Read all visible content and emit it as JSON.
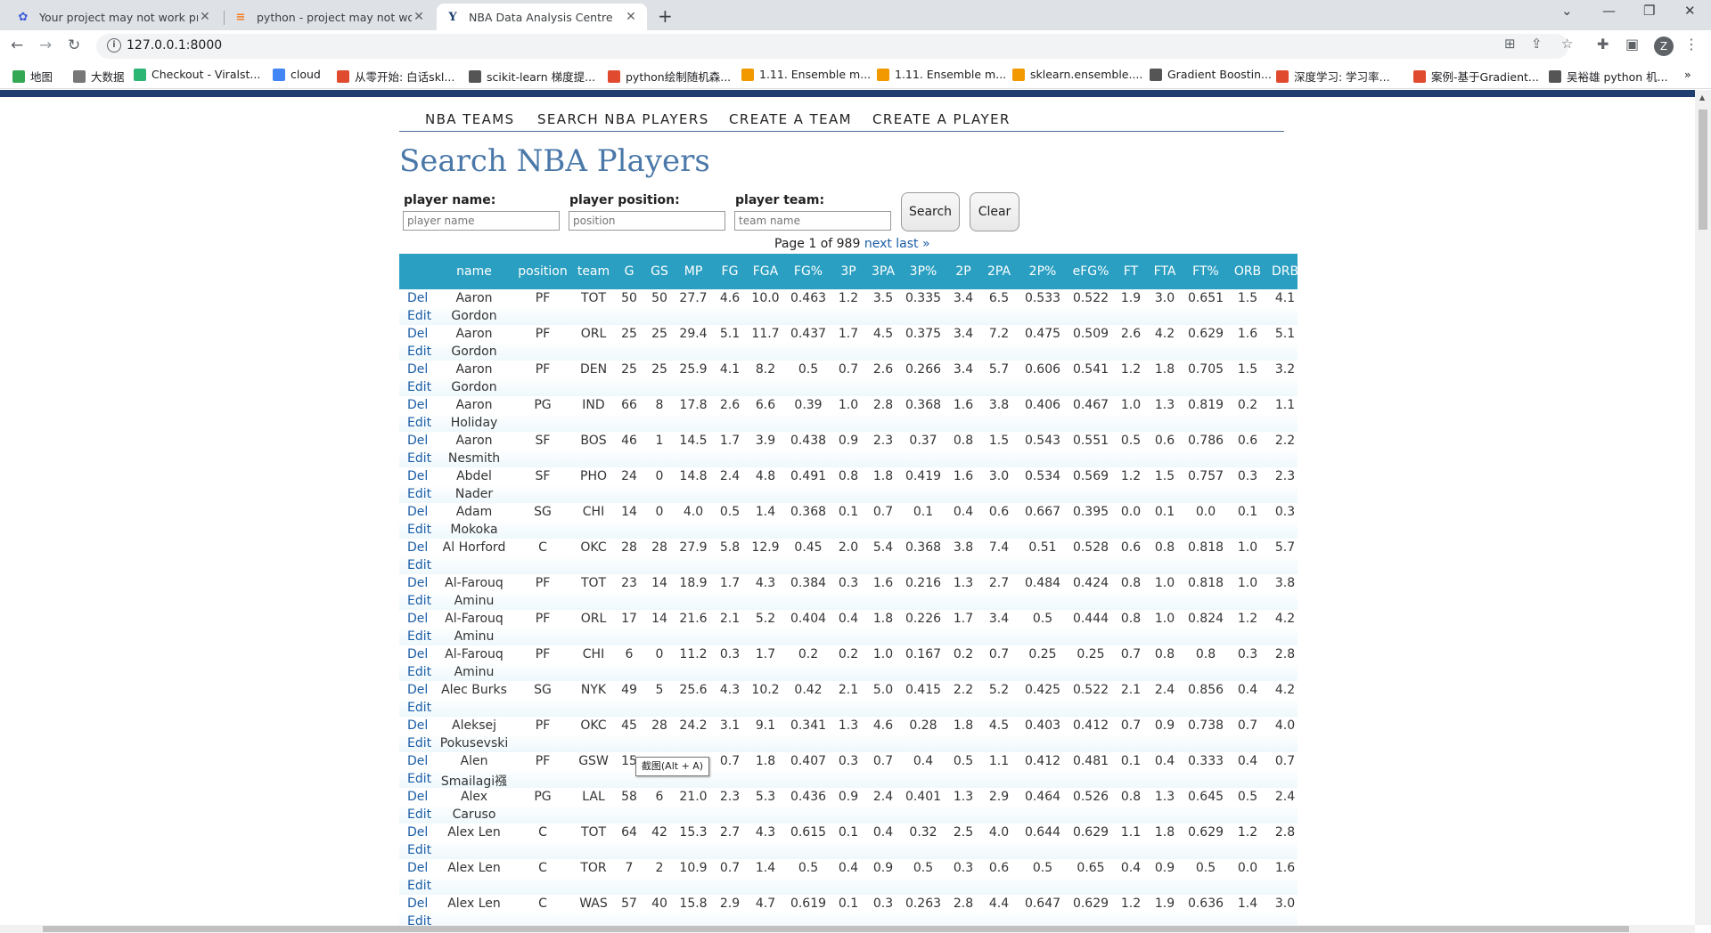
{
  "tabs": [
    {
      "title": "Your project may not work pro",
      "icon": "paw-icon"
    },
    {
      "title": "python - project may not work",
      "icon": "stack-icon"
    },
    {
      "title": "NBA Data Analysis Centre",
      "icon": "y-icon"
    }
  ],
  "url": "127.0.0.1:8000",
  "profile_initial": "Z",
  "bookmarks": [
    {
      "label": "地图",
      "color": "#34a853"
    },
    {
      "label": "大数据",
      "color": "#777777"
    },
    {
      "label": "Checkout - Viralst...",
      "color": "#2bb673"
    },
    {
      "label": "cloud",
      "color": "#4285f4"
    },
    {
      "label": "从零开始: 白话skl...",
      "color": "#e04a2f"
    },
    {
      "label": "scikit-learn 梯度提...",
      "color": "#555555"
    },
    {
      "label": "python绘制随机森...",
      "color": "#e04a2f"
    },
    {
      "label": "1.11. Ensemble m...",
      "color": "#f29900"
    },
    {
      "label": "1.11. Ensemble m...",
      "color": "#f29900"
    },
    {
      "label": "sklearn.ensemble....",
      "color": "#f29900"
    },
    {
      "label": "Gradient Boostin...",
      "color": "#555555"
    },
    {
      "label": "深度学习: 学习率...",
      "color": "#e04a2f"
    },
    {
      "label": "案例-基于Gradient...",
      "color": "#e04a2f"
    },
    {
      "label": "吴裕雄 python 机...",
      "color": "#555555"
    }
  ],
  "bookmarks_more": "»",
  "menu": [
    "NBA TEAMS",
    "SEARCH NBA PLAYERS",
    "CREATE A TEAM",
    "CREATE A PLAYER"
  ],
  "heading": "Search NBA Players",
  "search": {
    "name_label": "player name:",
    "name_placeholder": "player name",
    "position_label": "player position:",
    "position_placeholder": "position",
    "team_label": "player team:",
    "team_placeholder": "team name",
    "search_button": "Search",
    "clear_button": "Clear"
  },
  "pager": {
    "text": "Page 1 of 989",
    "next": "next",
    "last": "last »"
  },
  "columns": [
    "name",
    "position",
    "team",
    "G",
    "GS",
    "MP",
    "FG",
    "FGA",
    "FG%",
    "3P",
    "3PA",
    "3P%",
    "2P",
    "2PA",
    "2P%",
    "eFG%",
    "FT",
    "FTA",
    "FT%",
    "ORB",
    "DRB"
  ],
  "row_actions": {
    "delete": "Del",
    "edit": "Edit"
  },
  "rows": [
    {
      "name": [
        "Aaron",
        "Gordon"
      ],
      "vals": [
        "PF",
        "TOT",
        "50",
        "50",
        "27.7",
        "4.6",
        "10.0",
        "0.463",
        "1.2",
        "3.5",
        "0.335",
        "3.4",
        "6.5",
        "0.533",
        "0.522",
        "1.9",
        "3.0",
        "0.651",
        "1.5",
        "4.1"
      ]
    },
    {
      "name": [
        "Aaron",
        "Gordon"
      ],
      "vals": [
        "PF",
        "ORL",
        "25",
        "25",
        "29.4",
        "5.1",
        "11.7",
        "0.437",
        "1.7",
        "4.5",
        "0.375",
        "3.4",
        "7.2",
        "0.475",
        "0.509",
        "2.6",
        "4.2",
        "0.629",
        "1.6",
        "5.1"
      ]
    },
    {
      "name": [
        "Aaron",
        "Gordon"
      ],
      "vals": [
        "PF",
        "DEN",
        "25",
        "25",
        "25.9",
        "4.1",
        "8.2",
        "0.5",
        "0.7",
        "2.6",
        "0.266",
        "3.4",
        "5.7",
        "0.606",
        "0.541",
        "1.2",
        "1.8",
        "0.705",
        "1.5",
        "3.2"
      ]
    },
    {
      "name": [
        "Aaron",
        "Holiday"
      ],
      "vals": [
        "PG",
        "IND",
        "66",
        "8",
        "17.8",
        "2.6",
        "6.6",
        "0.39",
        "1.0",
        "2.8",
        "0.368",
        "1.6",
        "3.8",
        "0.406",
        "0.467",
        "1.0",
        "1.3",
        "0.819",
        "0.2",
        "1.1"
      ]
    },
    {
      "name": [
        "Aaron",
        "Nesmith"
      ],
      "vals": [
        "SF",
        "BOS",
        "46",
        "1",
        "14.5",
        "1.7",
        "3.9",
        "0.438",
        "0.9",
        "2.3",
        "0.37",
        "0.8",
        "1.5",
        "0.543",
        "0.551",
        "0.5",
        "0.6",
        "0.786",
        "0.6",
        "2.2"
      ]
    },
    {
      "name": [
        "Abdel",
        "Nader"
      ],
      "vals": [
        "SF",
        "PHO",
        "24",
        "0",
        "14.8",
        "2.4",
        "4.8",
        "0.491",
        "0.8",
        "1.8",
        "0.419",
        "1.6",
        "3.0",
        "0.534",
        "0.569",
        "1.2",
        "1.5",
        "0.757",
        "0.3",
        "2.3"
      ]
    },
    {
      "name": [
        "Adam",
        "Mokoka"
      ],
      "vals": [
        "SG",
        "CHI",
        "14",
        "0",
        "4.0",
        "0.5",
        "1.4",
        "0.368",
        "0.1",
        "0.7",
        "0.1",
        "0.4",
        "0.6",
        "0.667",
        "0.395",
        "0.0",
        "0.1",
        "0.0",
        "0.1",
        "0.3"
      ]
    },
    {
      "name": [
        "Al Horford",
        ""
      ],
      "vals": [
        "C",
        "OKC",
        "28",
        "28",
        "27.9",
        "5.8",
        "12.9",
        "0.45",
        "2.0",
        "5.4",
        "0.368",
        "3.8",
        "7.4",
        "0.51",
        "0.528",
        "0.6",
        "0.8",
        "0.818",
        "1.0",
        "5.7"
      ]
    },
    {
      "name": [
        "Al-Farouq",
        "Aminu"
      ],
      "vals": [
        "PF",
        "TOT",
        "23",
        "14",
        "18.9",
        "1.7",
        "4.3",
        "0.384",
        "0.3",
        "1.6",
        "0.216",
        "1.3",
        "2.7",
        "0.484",
        "0.424",
        "0.8",
        "1.0",
        "0.818",
        "1.0",
        "3.8"
      ]
    },
    {
      "name": [
        "Al-Farouq",
        "Aminu"
      ],
      "vals": [
        "PF",
        "ORL",
        "17",
        "14",
        "21.6",
        "2.1",
        "5.2",
        "0.404",
        "0.4",
        "1.8",
        "0.226",
        "1.7",
        "3.4",
        "0.5",
        "0.444",
        "0.8",
        "1.0",
        "0.824",
        "1.2",
        "4.2"
      ]
    },
    {
      "name": [
        "Al-Farouq",
        "Aminu"
      ],
      "vals": [
        "PF",
        "CHI",
        "6",
        "0",
        "11.2",
        "0.3",
        "1.7",
        "0.2",
        "0.2",
        "1.0",
        "0.167",
        "0.2",
        "0.7",
        "0.25",
        "0.25",
        "0.7",
        "0.8",
        "0.8",
        "0.3",
        "2.8"
      ]
    },
    {
      "name": [
        "Alec Burks",
        ""
      ],
      "vals": [
        "SG",
        "NYK",
        "49",
        "5",
        "25.6",
        "4.3",
        "10.2",
        "0.42",
        "2.1",
        "5.0",
        "0.415",
        "2.2",
        "5.2",
        "0.425",
        "0.522",
        "2.1",
        "2.4",
        "0.856",
        "0.4",
        "4.2"
      ]
    },
    {
      "name": [
        "Aleksej",
        "Pokusevski"
      ],
      "vals": [
        "PF",
        "OKC",
        "45",
        "28",
        "24.2",
        "3.1",
        "9.1",
        "0.341",
        "1.3",
        "4.6",
        "0.28",
        "1.8",
        "4.5",
        "0.403",
        "0.412",
        "0.7",
        "0.9",
        "0.738",
        "0.7",
        "4.0"
      ]
    },
    {
      "name": [
        "Alen",
        "Smailagi襁"
      ],
      "vals": [
        "PF",
        "GSW",
        "15",
        "",
        "",
        "0.7",
        "1.8",
        "0.407",
        "0.3",
        "0.7",
        "0.4",
        "0.5",
        "1.1",
        "0.412",
        "0.481",
        "0.1",
        "0.4",
        "0.333",
        "0.4",
        "0.7"
      ]
    },
    {
      "name": [
        "Alex",
        "Caruso"
      ],
      "vals": [
        "PG",
        "LAL",
        "58",
        "6",
        "21.0",
        "2.3",
        "5.3",
        "0.436",
        "0.9",
        "2.4",
        "0.401",
        "1.3",
        "2.9",
        "0.464",
        "0.526",
        "0.8",
        "1.3",
        "0.645",
        "0.5",
        "2.4"
      ]
    },
    {
      "name": [
        "Alex Len",
        ""
      ],
      "vals": [
        "C",
        "TOT",
        "64",
        "42",
        "15.3",
        "2.7",
        "4.3",
        "0.615",
        "0.1",
        "0.4",
        "0.32",
        "2.5",
        "4.0",
        "0.644",
        "0.629",
        "1.1",
        "1.8",
        "0.629",
        "1.2",
        "2.8"
      ]
    },
    {
      "name": [
        "Alex Len",
        ""
      ],
      "vals": [
        "C",
        "TOR",
        "7",
        "2",
        "10.9",
        "0.7",
        "1.4",
        "0.5",
        "0.4",
        "0.9",
        "0.5",
        "0.3",
        "0.6",
        "0.5",
        "0.65",
        "0.4",
        "0.9",
        "0.5",
        "0.0",
        "1.6"
      ]
    },
    {
      "name": [
        "Alex Len",
        ""
      ],
      "vals": [
        "C",
        "WAS",
        "57",
        "40",
        "15.8",
        "2.9",
        "4.7",
        "0.619",
        "0.1",
        "0.3",
        "0.263",
        "2.8",
        "4.4",
        "0.647",
        "0.629",
        "1.2",
        "1.9",
        "0.636",
        "1.4",
        "3.0"
      ]
    }
  ],
  "tooltip": "截图(Alt + A)"
}
